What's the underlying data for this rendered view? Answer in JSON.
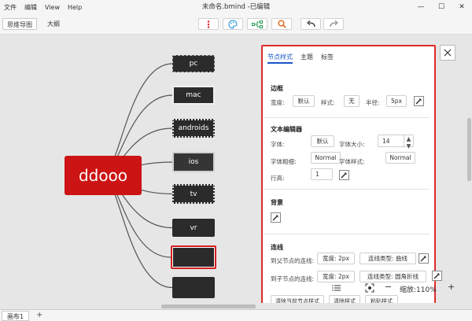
{
  "menubar": {
    "items": [
      "文件",
      "编辑",
      "View",
      "Help"
    ],
    "title": "未命名.bmind -已编辑",
    "controls": {
      "minimize": "—",
      "maximize": "☐",
      "close": "✕"
    }
  },
  "toolbar": {
    "tabs": [
      "思维导图",
      "大纲"
    ],
    "icons": [
      "more-vertical-icon",
      "palette-icon",
      "structure-icon",
      "search-icon",
      "undo-icon",
      "redo-icon"
    ]
  },
  "mindmap": {
    "root": "ddooo",
    "root_color": "#cc1414",
    "children": [
      {
        "label": "pc",
        "border": "dashed"
      },
      {
        "label": "mac",
        "border": "solid"
      },
      {
        "label": "androids",
        "border": "dotted"
      },
      {
        "label": "ios",
        "border": "solid"
      },
      {
        "label": "tv",
        "border": "dotted"
      },
      {
        "label": "vr",
        "border": "none"
      },
      {
        "label": "",
        "border": "selected"
      },
      {
        "label": "",
        "border": "none"
      }
    ],
    "line_color": "#555555",
    "node_color": "#2b2b2b"
  },
  "panel": {
    "tabs": [
      "节点样式",
      "主题",
      "标签"
    ],
    "border": {
      "title": "边框",
      "width_label": "宽度:",
      "width_value": "默认",
      "style_label": "样式:",
      "style_value": "无",
      "radius_label": "半径:",
      "radius_value": "5px"
    },
    "text_editor": {
      "title": "文本编辑器",
      "font_label": "字体:",
      "font_value": "默认",
      "size_label": "字体大小:",
      "size_value": "14",
      "weight_label": "字体粗细:",
      "weight_value": "Normal",
      "fstyle_label": "字体样式:",
      "fstyle_value": "Normal",
      "lineheight_label": "行高:",
      "lineheight_value": "1"
    },
    "background": {
      "title": "背景"
    },
    "connection": {
      "title": "连线",
      "parent_label": "到父节点的连线:",
      "parent_width": "宽度: 2px",
      "parent_type": "连线类型: 曲线",
      "child_label": "到子节点的连线:",
      "child_width": "宽度: 2px",
      "child_type": "连线类型: 圆角折线"
    },
    "bottom_buttons": [
      "清除当前节点样式",
      "清除样式",
      "粘贴样式"
    ],
    "highlight_color": "#e02a2a",
    "accent_color": "#1a56c8"
  },
  "zoom": {
    "label": "缩放:110%",
    "minus": "−",
    "plus": "+"
  },
  "status": {
    "sheet": "画布1",
    "add": "+"
  }
}
